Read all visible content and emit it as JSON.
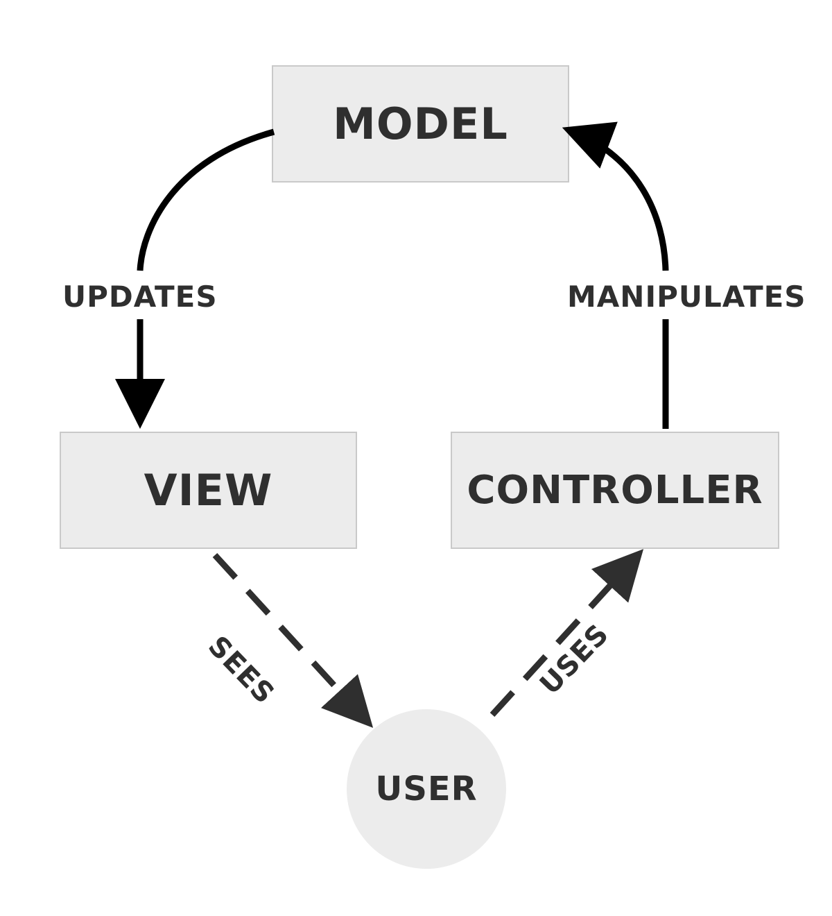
{
  "nodes": {
    "model": "MODEL",
    "view": "VIEW",
    "controller": "CONTROLLER",
    "user": "USER"
  },
  "edges": {
    "model_to_view": "UPDATES",
    "controller_to_model": "MANIPULATES",
    "view_to_user": "SEES",
    "user_to_controller": "USES"
  },
  "colors": {
    "node_fill": "#ececec",
    "node_stroke": "#c9c9c9",
    "text": "#2f2f2f",
    "arrow_solid": "#000000",
    "arrow_dashed": "#2f2f2f"
  }
}
